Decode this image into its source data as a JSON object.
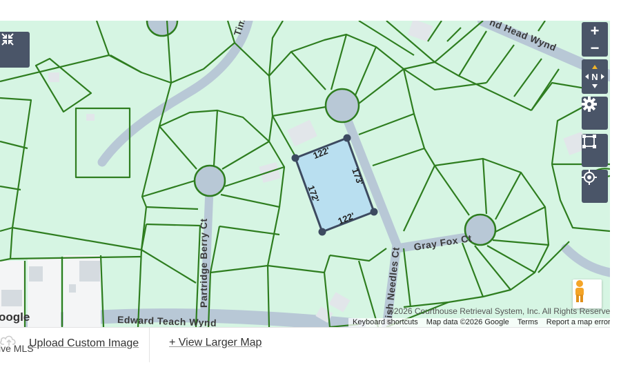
{
  "map": {
    "streets": {
      "edward_teach": "Edward Teach Wynd",
      "partridge_berry": "Partridge Berry Ct",
      "gray_fox": "Gray Fox Ct",
      "spanish_needles": "nish Needles Ct",
      "dead_head": "nd Head Wynd",
      "tim": "Tim"
    },
    "dimensions": {
      "top": "122'",
      "right": "173'",
      "left": "172'",
      "bottom": "122'"
    },
    "attribution": "©2026 Courthouse Retrieval System, Inc. All Rights Reserved.",
    "google_links": {
      "keyboard": "Keyboard shortcuts",
      "mapdata": "Map data ©2026 Google",
      "terms": "Terms",
      "report": "Report a map error"
    },
    "google_logo": "oogle",
    "compass_label": "N",
    "colors": {
      "land": "#d6f5e3",
      "parcel_line": "#2e7d1f",
      "road": "#b8c8d6",
      "selected_parcel": "#b9dff0",
      "control_bg": "#4a5568"
    }
  },
  "bottom": {
    "mls": "ive MLS",
    "upload": "Upload Custom Image",
    "view_larger": "+ View Larger Map"
  }
}
